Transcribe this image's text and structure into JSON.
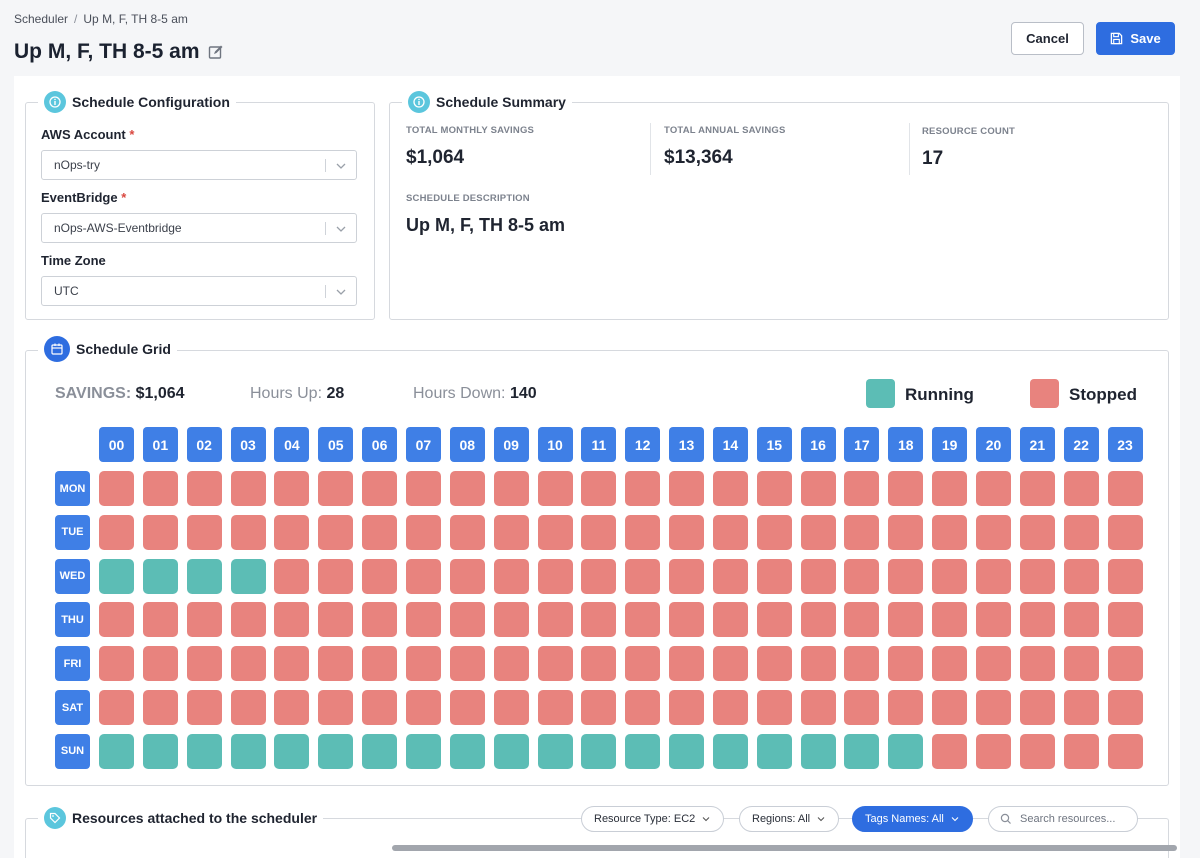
{
  "breadcrumb": {
    "root": "Scheduler",
    "separator": "/",
    "current": "Up M, F, TH 8-5 am"
  },
  "page": {
    "title": "Up M, F, TH 8-5 am"
  },
  "actions": {
    "cancel_label": "Cancel",
    "save_label": "Save"
  },
  "config": {
    "title": "Schedule Configuration",
    "aws_account": {
      "label": "AWS Account",
      "required": "*",
      "value": "nOps-try"
    },
    "eventbridge": {
      "label": "EventBridge",
      "required": "*",
      "value": "nOps-AWS-Eventbridge"
    },
    "timezone": {
      "label": "Time Zone",
      "value": "UTC"
    }
  },
  "summary": {
    "title": "Schedule Summary",
    "monthly_label": "TOTAL MONTHLY SAVINGS",
    "monthly_value": "$1,064",
    "annual_label": "TOTAL ANNUAL SAVINGS",
    "annual_value": "$13,364",
    "count_label": "RESOURCE COUNT",
    "count_value": "17",
    "desc_label": "SCHEDULE DESCRIPTION",
    "desc_value": "Up M, F, TH 8-5 am"
  },
  "grid": {
    "title": "Schedule Grid",
    "savings_label": "SAVINGS:",
    "savings_value": "$1,064",
    "hours_up_label": "Hours Up:",
    "hours_up_value": "28",
    "hours_down_label": "Hours Down:",
    "hours_down_value": "140",
    "legend_running": "Running",
    "legend_stopped": "Stopped",
    "hours": [
      "00",
      "01",
      "02",
      "03",
      "04",
      "05",
      "06",
      "07",
      "08",
      "09",
      "10",
      "11",
      "12",
      "13",
      "14",
      "15",
      "16",
      "17",
      "18",
      "19",
      "20",
      "21",
      "22",
      "23"
    ],
    "days": [
      "MON",
      "TUE",
      "WED",
      "THU",
      "FRI",
      "SAT",
      "SUN"
    ],
    "running": {
      "MON": [],
      "TUE": [],
      "WED": [
        0,
        1,
        2,
        3
      ],
      "THU": [],
      "FRI": [],
      "SAT": [],
      "SUN": [
        0,
        1,
        2,
        3,
        4,
        5,
        6,
        7,
        8,
        9,
        10,
        11,
        12,
        13,
        14,
        15,
        16,
        17,
        18
      ]
    },
    "colors": {
      "running": "#5cbdb5",
      "stopped": "#e8837e",
      "header": "#3f7fe6"
    }
  },
  "resources": {
    "title": "Resources attached to the scheduler",
    "filter_type": "Resource Type: EC2",
    "filter_regions": "Regions: All",
    "filter_tags": "Tags Names: All",
    "search_placeholder": "Search resources..."
  }
}
